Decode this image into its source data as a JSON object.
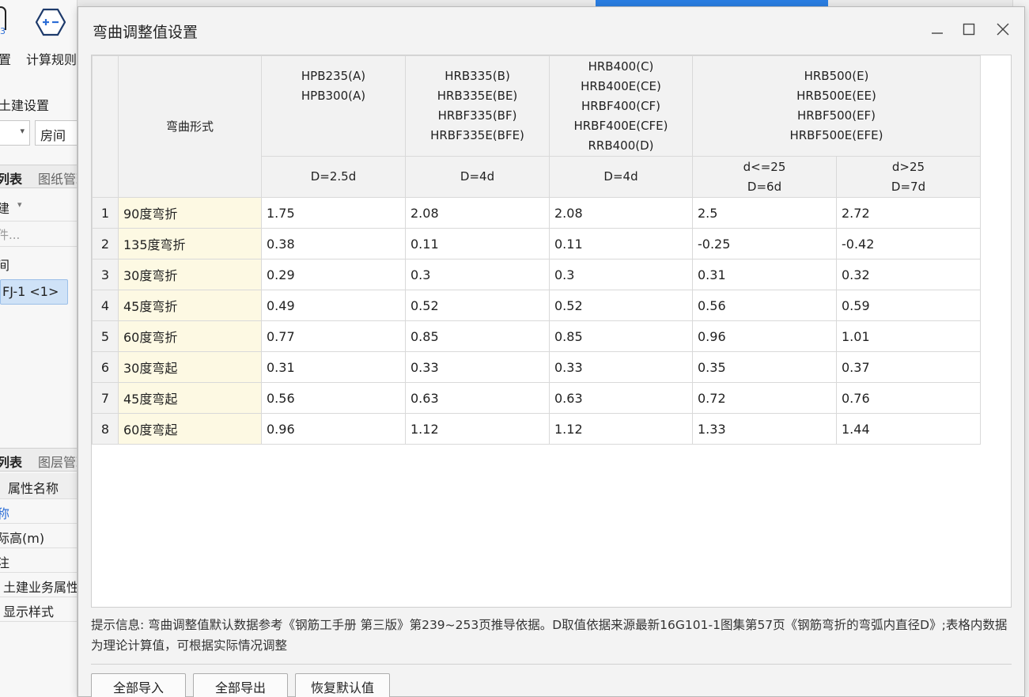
{
  "background": {
    "toolbar": {
      "partial_label": "置",
      "calc_label": "计算规则"
    },
    "section_title": "土建设置",
    "select_value": "房间",
    "tabs_top": {
      "active": "列表",
      "inactive": "图纸管理"
    },
    "tree_items": [
      "建",
      "件...",
      "间"
    ],
    "selected_item": "FJ-1 <1>",
    "tabs_bottom": {
      "active": "列表",
      "inactive": "图层管理"
    },
    "prop_header": "属性名称",
    "props": [
      "称",
      "际高(m)",
      "注",
      "土建业务属性",
      "显示样式"
    ]
  },
  "dialog": {
    "title": "弯曲调整值设置",
    "minimize_glyph": "—",
    "close_glyph": "✕",
    "table": {
      "shape_header": "弯曲形式",
      "groups": [
        {
          "lines": [
            "HPB235(A)",
            "HPB300(A)"
          ]
        },
        {
          "lines": [
            "HRB335(B)",
            "HRB335E(BE)",
            "HRBF335(BF)",
            "HRBF335E(BFE)"
          ]
        },
        {
          "lines": [
            "HRB400(C)",
            "HRB400E(CE)",
            "HRBF400(CF)",
            "HRBF400E(CFE)",
            "RRB400(D)"
          ]
        },
        {
          "lines": [
            "HRB500(E)",
            "HRB500E(EE)",
            "HRBF500(EF)",
            "HRBF500E(EFE)"
          ]
        }
      ],
      "sub_headers": [
        {
          "lines": [
            "D=2.5d"
          ]
        },
        {
          "lines": [
            "D=4d"
          ]
        },
        {
          "lines": [
            "D=4d"
          ]
        },
        {
          "lines": [
            "d<=25",
            "D=6d"
          ]
        },
        {
          "lines": [
            "d>25",
            "D=7d"
          ]
        }
      ],
      "rows": [
        {
          "num": "1",
          "shape": "90度弯折",
          "values": [
            "1.75",
            "2.08",
            "2.08",
            "2.5",
            "2.72"
          ]
        },
        {
          "num": "2",
          "shape": "135度弯折",
          "values": [
            "0.38",
            "0.11",
            "0.11",
            "-0.25",
            "-0.42"
          ]
        },
        {
          "num": "3",
          "shape": "30度弯折",
          "values": [
            "0.29",
            "0.3",
            "0.3",
            "0.31",
            "0.32"
          ]
        },
        {
          "num": "4",
          "shape": "45度弯折",
          "values": [
            "0.49",
            "0.52",
            "0.52",
            "0.56",
            "0.59"
          ]
        },
        {
          "num": "5",
          "shape": "60度弯折",
          "values": [
            "0.77",
            "0.85",
            "0.85",
            "0.96",
            "1.01"
          ]
        },
        {
          "num": "6",
          "shape": "30度弯起",
          "values": [
            "0.31",
            "0.33",
            "0.33",
            "0.35",
            "0.37"
          ]
        },
        {
          "num": "7",
          "shape": "45度弯起",
          "values": [
            "0.56",
            "0.63",
            "0.63",
            "0.72",
            "0.76"
          ]
        },
        {
          "num": "8",
          "shape": "60度弯起",
          "values": [
            "0.96",
            "1.12",
            "1.12",
            "1.33",
            "1.44"
          ]
        }
      ]
    },
    "hint": "提示信息: 弯曲调整值默认数据参考《钢筋工手册 第三版》第239~253页推导依据。D取值依据来源最新16G101-1图集第57页《钢筋弯折的弯弧内直径D》;表格内数据为理论计算值，可根据实际情况调整",
    "buttons": {
      "import_all": "全部导入",
      "export_all": "全部导出",
      "restore_default": "恢复默认值"
    }
  }
}
